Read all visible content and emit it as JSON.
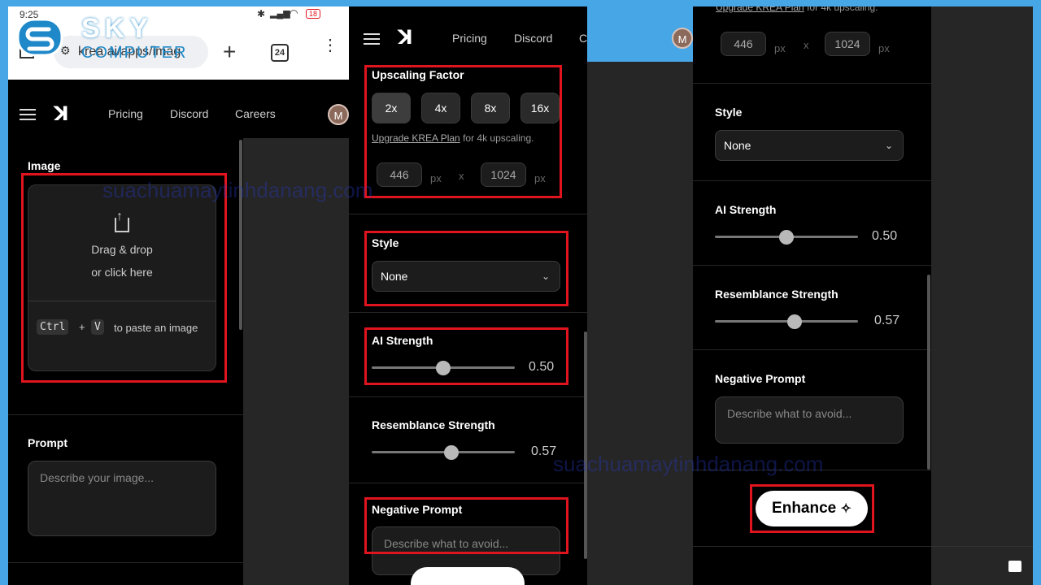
{
  "brand": {
    "name_line1": "SKY",
    "name_line2": "COMPUTER"
  },
  "status_bar": {
    "time": "9:25",
    "battery": "18"
  },
  "browser": {
    "url": "krea.ai/apps/imag",
    "tab_count": "24"
  },
  "nav": {
    "links": [
      "Pricing",
      "Discord",
      "Careers"
    ],
    "avatar": "M"
  },
  "image_section": {
    "title": "Image",
    "drop_line1": "Drag & drop",
    "drop_line2": "or click here",
    "key1": "Ctrl",
    "plus": "+",
    "key2": "V",
    "paste_text": "to paste an image"
  },
  "prompt": {
    "title": "Prompt",
    "placeholder": "Describe your image..."
  },
  "upscale": {
    "title": "Upscaling Factor",
    "options": [
      "2x",
      "4x",
      "8x",
      "16x"
    ],
    "selected": "2x",
    "upgrade_link": "Upgrade KREA Plan",
    "upgrade_rest": "for 4k upscaling.",
    "width": "446",
    "height": "1024",
    "unit": "px",
    "times": "x"
  },
  "style": {
    "title": "Style",
    "value": "None"
  },
  "ai_strength": {
    "title": "AI Strength",
    "value": "0.50",
    "level": 0.5
  },
  "resemblance": {
    "title": "Resemblance Strength",
    "value": "0.57",
    "level": 0.57
  },
  "negative": {
    "title": "Negative Prompt",
    "placeholder": "Describe what to avoid..."
  },
  "enhance": {
    "label": "Enhance"
  },
  "watermark": {
    "text1": "suachuamaytinhdanang.com",
    "text2": "suachuamaytinhdanang.com"
  },
  "colors": {
    "highlight": "#e0141e",
    "frame": "#47a6e6",
    "panel": "#000000"
  }
}
